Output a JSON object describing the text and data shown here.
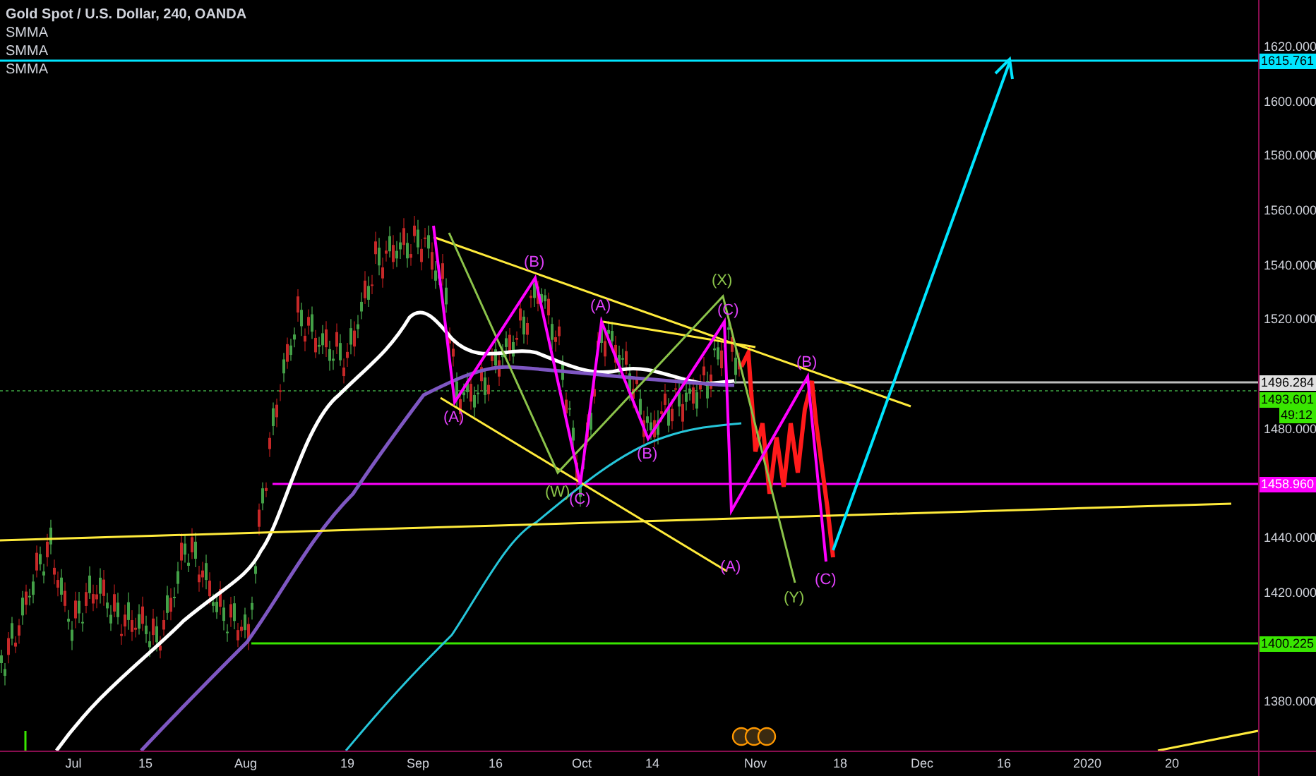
{
  "legend": {
    "title": "Gold Spot / U.S. Dollar, 240, OANDA",
    "indicators": [
      "SMMA",
      "SMMA",
      "SMMA"
    ]
  },
  "wave_labels": [
    {
      "text": "(X)",
      "color": "#8bc34a"
    },
    {
      "text": "(W)",
      "color": "#8bc34a"
    },
    {
      "text": "(Y)",
      "color": "#8bc34a"
    },
    {
      "text": "(B)",
      "color": "#e040fb"
    },
    {
      "text": "(A)",
      "color": "#e040fb"
    },
    {
      "text": "(C)",
      "color": "#e040fb"
    },
    {
      "text": "(A)",
      "color": "#e040fb"
    },
    {
      "text": "(B)",
      "color": "#e040fb"
    },
    {
      "text": "(C)",
      "color": "#e040fb"
    },
    {
      "text": "(A)",
      "color": "#e040fb"
    },
    {
      "text": "(B)",
      "color": "#e040fb"
    },
    {
      "text": "(C)",
      "color": "#e040fb"
    }
  ],
  "price_axis": {
    "ticks": [
      "1620.000",
      "1600.000",
      "1580.000",
      "1560.000",
      "1540.000",
      "1520.000",
      "1480.000",
      "1440.000",
      "1420.000",
      "1380.000"
    ],
    "tags": [
      {
        "text": "1615.761",
        "kind": "price",
        "color": "#00e5ff"
      },
      {
        "text": "1496.284",
        "kind": "price",
        "color": "#e0e0e0"
      },
      {
        "text": "1493.601",
        "kind": "price",
        "color": "#39e600"
      },
      {
        "text": "49:12",
        "kind": "countdown",
        "color": "#39e600"
      },
      {
        "text": "1458.960",
        "kind": "price",
        "color": "#ff00ff"
      },
      {
        "text": "1400.225",
        "kind": "price",
        "color": "#39e600"
      }
    ]
  },
  "time_axis": [
    "Jul",
    "15",
    "Aug",
    "19",
    "Sep",
    "16",
    "Oct",
    "14",
    "Nov",
    "18",
    "Dec",
    "16",
    "2020",
    "20"
  ]
}
